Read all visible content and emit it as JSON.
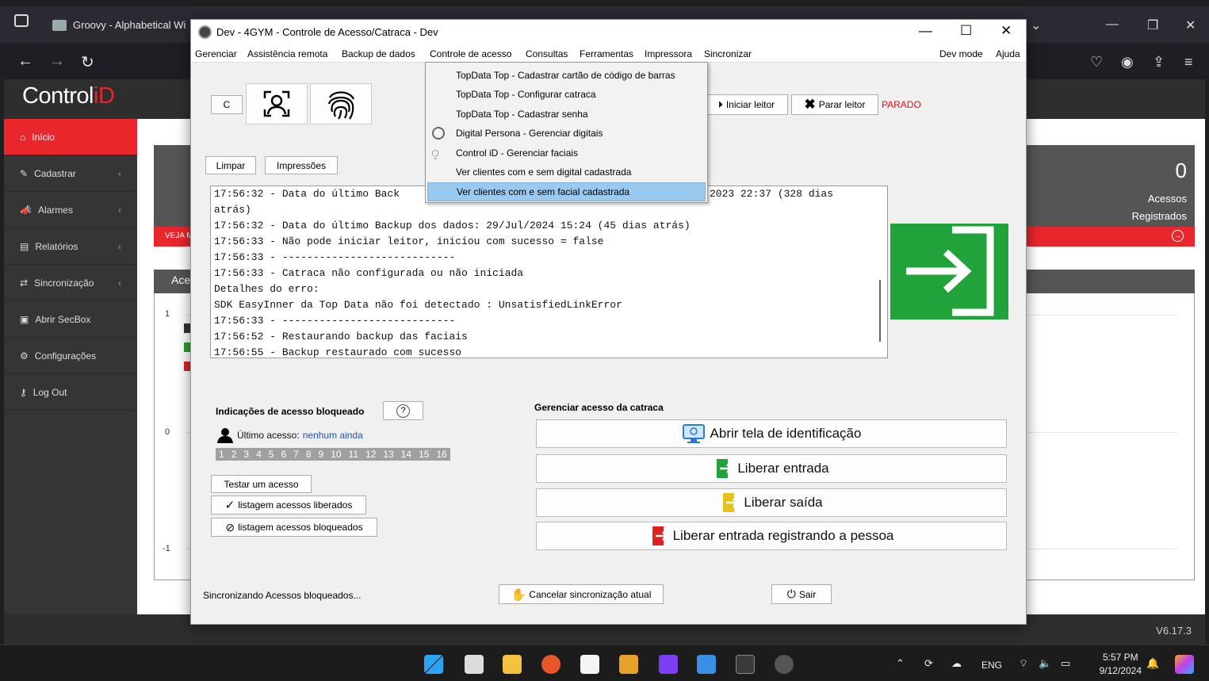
{
  "browser": {
    "tab_title": "Groovy - Alphabetical Wi",
    "nav_icons": [
      "back-icon",
      "forward-icon",
      "reload-icon"
    ]
  },
  "cid": {
    "logo_text": "Control",
    "logo_accent": "iD",
    "sidebar": [
      {
        "label": "Início",
        "icon": "home-icon",
        "active": true
      },
      {
        "label": "Cadastrar",
        "icon": "edit-icon",
        "chevron": true
      },
      {
        "label": "Alarmes",
        "icon": "megaphone-icon",
        "chevron": true
      },
      {
        "label": "Relatórios",
        "icon": "report-icon",
        "chevron": true
      },
      {
        "label": "Sincronização",
        "icon": "sync-icon",
        "chevron": true
      },
      {
        "label": "Abrir SecBox",
        "icon": "box-icon"
      },
      {
        "label": "Configurações",
        "icon": "gears-icon"
      },
      {
        "label": "Log Out",
        "icon": "key-icon"
      }
    ],
    "red_strip_text": "VEJA M",
    "counter_value": "0",
    "counter_label_1": "Acessos",
    "counter_label_2": "Registrados",
    "chart_title": "Ace",
    "chart_ticks": [
      "1",
      "0",
      "-1"
    ],
    "version": "V6.17.3"
  },
  "dialog": {
    "title": "Dev - 4GYM - Controle de Acesso/Catraca - Dev",
    "menu": [
      "Gerenciar",
      "Assistência remota",
      "Backup de dados",
      "Controle de acesso",
      "Consultas",
      "Ferramentas",
      "Impressora",
      "Sincronizar"
    ],
    "menu_right": [
      "Dev mode",
      "Ajuda"
    ],
    "c_button": "C",
    "start_reader": "Iniciar leitor",
    "stop_reader": "Parar leitor",
    "reader_status": "PARADO",
    "clear_button": "Limpar",
    "prints_button": "Impressões",
    "log_top_right": "2023 22:37 (328 dias",
    "log_lines": [
      "17:56:32 - Data do último Back",
      "atrás)",
      "17:56:32 - Data do último Backup dos dados: 29/Jul/2024 15:24 (45 dias atrás)",
      "17:56:33 - Não pode iniciar leitor, iniciou com sucesso = false",
      "17:56:33 - ----------------------------",
      "17:56:33 - Catraca não configurada ou não iniciada",
      "Detalhes do erro:",
      "SDK EasyInner da Top Data não foi detectado : UnsatisfiedLinkError",
      "17:56:33 - ----------------------------",
      "17:56:52 - Restaurando backup das faciais",
      "17:56:55 - Backup restaurado com sucesso"
    ],
    "blocked_title": "Indicações de acesso bloqueado",
    "help_button": "?",
    "last_access_label": "Último acesso:",
    "last_access_value": "nenhum ainda",
    "access_numbers": [
      "1",
      "2",
      "3",
      "4",
      "5",
      "6",
      "7",
      "8",
      "9",
      "10",
      "11",
      "12",
      "13",
      "14",
      "15",
      "16"
    ],
    "test_access": "Testar um acesso",
    "list_allowed": "listagem acessos liberados",
    "list_blocked": "listagem acessos bloqueados",
    "turnstile_title": "Gerenciar acesso da catraca",
    "open_id_screen": "Abrir tela de identificação",
    "release_entry": "Liberar entrada",
    "release_exit": "Liberar saída",
    "release_entry_register": "Liberar entrada registrando a pessoa",
    "sync_status": "Sincronizando Acessos bloqueados...",
    "cancel_sync": "Cancelar sincronização atual",
    "exit_button": "Sair"
  },
  "dropdown": {
    "items": [
      {
        "label": "TopData Top - Cadastrar cartão de código de barras",
        "icon": ""
      },
      {
        "label": "TopData Top - Configurar catraca",
        "icon": ""
      },
      {
        "label": "TopData Top - Cadastrar senha",
        "icon": ""
      },
      {
        "label": "Digital Persona - Gerenciar digitais",
        "icon": "fingerprint-icon"
      },
      {
        "label": "Control iD - Gerenciar faciais",
        "icon": "face-icon"
      },
      {
        "label": "Ver clientes com e sem digital cadastrada",
        "icon": ""
      },
      {
        "label": "Ver clientes com e sem facial cadastrada",
        "icon": "",
        "selected": true
      }
    ]
  },
  "taskbar": {
    "lang": "ENG",
    "time": "5:57 PM",
    "date": "9/12/2024"
  }
}
